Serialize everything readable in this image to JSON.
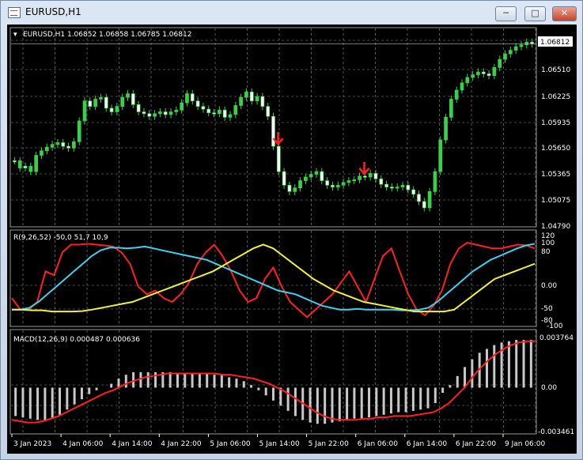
{
  "window": {
    "title": "EURUSD,H1",
    "minimize_label": "─",
    "maximize_label": "□",
    "close_label": "✕"
  },
  "header": {
    "dropdown_label": "▾",
    "symbol_info": "EURUSD,H1  1.06852 1.06858 1.06785 1.06812"
  },
  "price_panel": {
    "current_price": "1.06812",
    "tick_labels": [
      "1.06510",
      "1.06225",
      "1.05935",
      "1.05650",
      "1.05365",
      "1.05075",
      "1.04790"
    ]
  },
  "rsi_panel": {
    "label": "R(9,26,52) -50,0 51,7 10,9",
    "tick_labels": [
      "120",
      "100",
      "80",
      "0.00",
      "-50",
      "-80",
      "-100"
    ]
  },
  "macd_panel": {
    "label": "MACD(12,26,9) 0.000487 0.000636",
    "tick_labels": [
      "0.003764",
      "0.00",
      "-0.003461"
    ]
  },
  "time_axis": {
    "labels": [
      "3 Jan 2023",
      "4 Jan 06:00",
      "4 Jan 14:00",
      "4 Jan 22:00",
      "5 Jan 06:00",
      "5 Jan 14:00",
      "5 Jan 22:00",
      "6 Jan 06:00",
      "6 Jan 14:00",
      "6 Jan 22:00",
      "9 Jan 06:00"
    ]
  },
  "colors": {
    "background": "#000000",
    "grid": "#8a8a8a",
    "candle_up": "#39d04a",
    "candle_down": "#ffffff",
    "arrow": "#ff2020",
    "line_red": "#ff2020",
    "line_cyan": "#3cd2ef",
    "line_yellow": "#f2f23a",
    "histogram": "#c8c8c8"
  },
  "chart_data": [
    {
      "type": "line",
      "title": "EURUSD,H1",
      "xlabel": "",
      "ylabel": "",
      "ylim": [
        1.0479,
        1.0685
      ],
      "series": [
        {
          "values": [
            1.0552,
            1.0544,
            1.0546,
            1.054,
            1.0558,
            1.0563,
            1.0567,
            1.057,
            1.0572,
            1.0568,
            1.0566,
            1.0573,
            1.0596,
            1.0618,
            1.0612,
            1.062,
            1.0622,
            1.061,
            1.0606,
            1.0612,
            1.0622,
            1.0626,
            1.0614,
            1.0606,
            1.0604,
            1.0601,
            1.0604,
            1.0606,
            1.0603,
            1.0606,
            1.0608,
            1.0616,
            1.0626,
            1.0618,
            1.0612,
            1.0609,
            1.0605,
            1.0604,
            1.0608,
            1.06,
            1.0603,
            1.0613,
            1.0622,
            1.0628,
            1.0618,
            1.0623,
            1.0612,
            1.0601,
            1.0568,
            1.054,
            1.0525,
            1.0518,
            1.0522,
            1.053,
            1.0534,
            1.0537,
            1.054,
            1.053,
            1.0525,
            1.0523,
            1.0525,
            1.0528,
            1.053,
            1.0531,
            1.0535,
            1.0534,
            1.0538,
            1.0532,
            1.0526,
            1.0523,
            1.0522,
            1.0523,
            1.0525,
            1.052,
            1.0515,
            1.0507,
            1.05,
            1.0518,
            1.054,
            1.0575,
            1.06,
            1.062,
            1.063,
            1.0638,
            1.0644,
            1.0647,
            1.065,
            1.0648,
            1.0646,
            1.0655,
            1.0664,
            1.067,
            1.0674,
            1.0678,
            1.068,
            1.0683,
            1.0681
          ],
          "up_candles": [
            false,
            true,
            false,
            true,
            true,
            true,
            true,
            true,
            true,
            false,
            false,
            true,
            true,
            true,
            false,
            true,
            true,
            false,
            false,
            true,
            true,
            true,
            false,
            false,
            false,
            false,
            true,
            true,
            false,
            true,
            true,
            true,
            true,
            false,
            false,
            false,
            false,
            false,
            true,
            false,
            true,
            true,
            true,
            true,
            false,
            true,
            false,
            false,
            false,
            false,
            false,
            false,
            true,
            true,
            true,
            true,
            true,
            false,
            false,
            false,
            true,
            true,
            true,
            true,
            true,
            false,
            true,
            false,
            false,
            false,
            false,
            true,
            true,
            false,
            false,
            false,
            false,
            true,
            true,
            true,
            true,
            true,
            true,
            true,
            true,
            true,
            true,
            false,
            false,
            true,
            true,
            true,
            true,
            true,
            true,
            true,
            false
          ]
        }
      ],
      "current_price": 1.06812,
      "annotations": [
        {
          "type": "arrow-down",
          "index": 48
        },
        {
          "type": "arrow-down",
          "index": 64
        }
      ]
    },
    {
      "type": "line",
      "title": "R(9,26,52) -50,0 51,7 10,9",
      "xlabel": "",
      "ylabel": "",
      "ylim": [
        -120,
        120
      ],
      "series": [
        {
          "values": [
            -50,
            -80,
            -80,
            -60,
            20,
            10,
            70,
            90,
            90,
            92,
            90,
            88,
            85,
            70,
            40,
            -20,
            -40,
            -30,
            -50,
            -60,
            -40,
            -10,
            40,
            70,
            90,
            60,
            20,
            -30,
            -60,
            -50,
            0,
            30,
            -20,
            -60,
            -80,
            -100,
            -80,
            -60,
            -40,
            -10,
            20,
            -20,
            -60,
            0,
            60,
            80,
            20,
            -40,
            -80,
            -95,
            -70,
            -30,
            40,
            80,
            95,
            90,
            85,
            80,
            80,
            85,
            90,
            88,
            80
          ]
        },
        {
          "values": [
            -80,
            -80,
            -75,
            -60,
            -40,
            -20,
            0,
            20,
            40,
            60,
            75,
            82,
            82,
            80,
            82,
            85,
            80,
            75,
            70,
            65,
            60,
            55,
            50,
            40,
            30,
            20,
            10,
            0,
            -10,
            -20,
            -30,
            -35,
            -40,
            -50,
            -60,
            -70,
            -75,
            -80,
            -80,
            -78,
            -80,
            -80,
            -80,
            -80,
            -82,
            -82,
            -80,
            -75,
            -60,
            -40,
            -20,
            0,
            20,
            35,
            50,
            60,
            70,
            80,
            88,
            92
          ]
        },
        {
          "values": [
            -80,
            -80,
            -82,
            -82,
            -85,
            -85,
            -85,
            -84,
            -80,
            -75,
            -70,
            -65,
            -60,
            -50,
            -40,
            -30,
            -20,
            -10,
            0,
            10,
            20,
            35,
            50,
            65,
            80,
            90,
            80,
            60,
            40,
            20,
            0,
            -15,
            -30,
            -40,
            -50,
            -60,
            -65,
            -70,
            -75,
            -80,
            -85,
            -85,
            -85,
            -85,
            -80,
            -60,
            -40,
            -20,
            0,
            10,
            20,
            30,
            40
          ]
        }
      ]
    },
    {
      "type": "bar",
      "title": "MACD(12,26,9) 0.000487 0.000636",
      "xlabel": "",
      "ylabel": "",
      "ylim": [
        -0.003461,
        0.003764
      ],
      "values": [
        -0.0022,
        -0.0023,
        -0.0024,
        -0.0025,
        -0.0026,
        -0.0024,
        -0.0021,
        -0.0017,
        -0.0013,
        -0.0009,
        -0.0005,
        -0.0002,
        0.0,
        0.0003,
        0.0007,
        0.001,
        0.0012,
        0.0012,
        0.0012,
        0.0012,
        0.0012,
        0.0012,
        0.0011,
        0.0011,
        0.0011,
        0.0011,
        0.0011,
        0.001,
        0.001,
        0.0008,
        0.0007,
        0.0005,
        0.0002,
        -0.0002,
        -0.0006,
        -0.001,
        -0.0014,
        -0.0018,
        -0.0022,
        -0.0025,
        -0.0027,
        -0.0028,
        -0.0028,
        -0.0027,
        -0.0026,
        -0.0025,
        -0.0024,
        -0.0024,
        -0.0023,
        -0.0022,
        -0.0021,
        -0.002,
        -0.0019,
        -0.0019,
        -0.0018,
        -0.0017,
        -0.0016,
        -0.0012,
        -0.0004,
        0.0002,
        0.0009,
        0.0016,
        0.0022,
        0.0027,
        0.003,
        0.0033,
        0.0035,
        0.0036,
        0.0037,
        0.0037,
        0.0037
      ],
      "series": [
        {
          "values": [
            -0.0025,
            -0.0026,
            -0.0027,
            -0.0027,
            -0.0026,
            -0.0024,
            -0.0022,
            -0.0019,
            -0.0016,
            -0.0013,
            -0.001,
            -0.0007,
            -0.0004,
            -0.0002,
            0.0001,
            0.0004,
            0.0006,
            0.0008,
            0.0009,
            0.001,
            0.0011,
            0.0011,
            0.0011,
            0.0011,
            0.0011,
            0.0011,
            0.0011,
            0.001,
            0.001,
            0.0009,
            0.0008,
            0.0007,
            0.0005,
            0.0003,
            0.0,
            -0.0003,
            -0.0007,
            -0.0011,
            -0.0015,
            -0.0019,
            -0.0022,
            -0.0024,
            -0.0025,
            -0.0025,
            -0.0025,
            -0.0024,
            -0.0024,
            -0.0023,
            -0.0023,
            -0.0022,
            -0.0022,
            -0.0022,
            -0.0021,
            -0.002,
            -0.0019,
            -0.0016,
            -0.0012,
            -0.0006,
            0.0,
            0.0008,
            0.0015,
            0.0021,
            0.0026,
            0.003,
            0.0033,
            0.0035,
            0.0036,
            0.0036
          ]
        }
      ]
    }
  ]
}
